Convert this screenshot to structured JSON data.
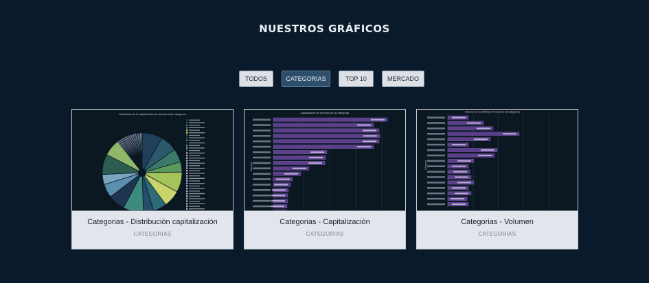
{
  "page": {
    "title": "NUESTROS GRÁFICOS"
  },
  "filters": [
    {
      "label": "TODOS",
      "active": false
    },
    {
      "label": "CATEGORIAS",
      "active": true
    },
    {
      "label": "TOP 10",
      "active": false
    },
    {
      "label": "MERCADO",
      "active": false
    }
  ],
  "cards": [
    {
      "title": "Categorias - Distribución capitalización",
      "tag": "CATEGORIAS",
      "chart_data": {
        "type": "pie",
        "title": "Distribución de la capitalización de mercado entre categorías",
        "slice_count": 36
      }
    },
    {
      "title": "Categorias - Capitalización",
      "tag": "CATEGORIAS",
      "chart_data": {
        "type": "bar",
        "orientation": "horizontal",
        "title": "Capitalización de mercado de las categorías",
        "ylabel": "Categoría",
        "bar_count": 18
      }
    },
    {
      "title": "Categorias - Volumen",
      "tag": "CATEGORIAS",
      "chart_data": {
        "type": "bar",
        "orientation": "horizontal",
        "title": "Volumen en las últimas 24 horas de las categorías",
        "ylabel": "Categoría",
        "bar_count": 17
      }
    }
  ],
  "colors": {
    "background": "#0a1a2a",
    "active_filter": "#2e4f6b",
    "bar_fill": "#5b3f8a",
    "card_bg": "#e3e5ec"
  }
}
